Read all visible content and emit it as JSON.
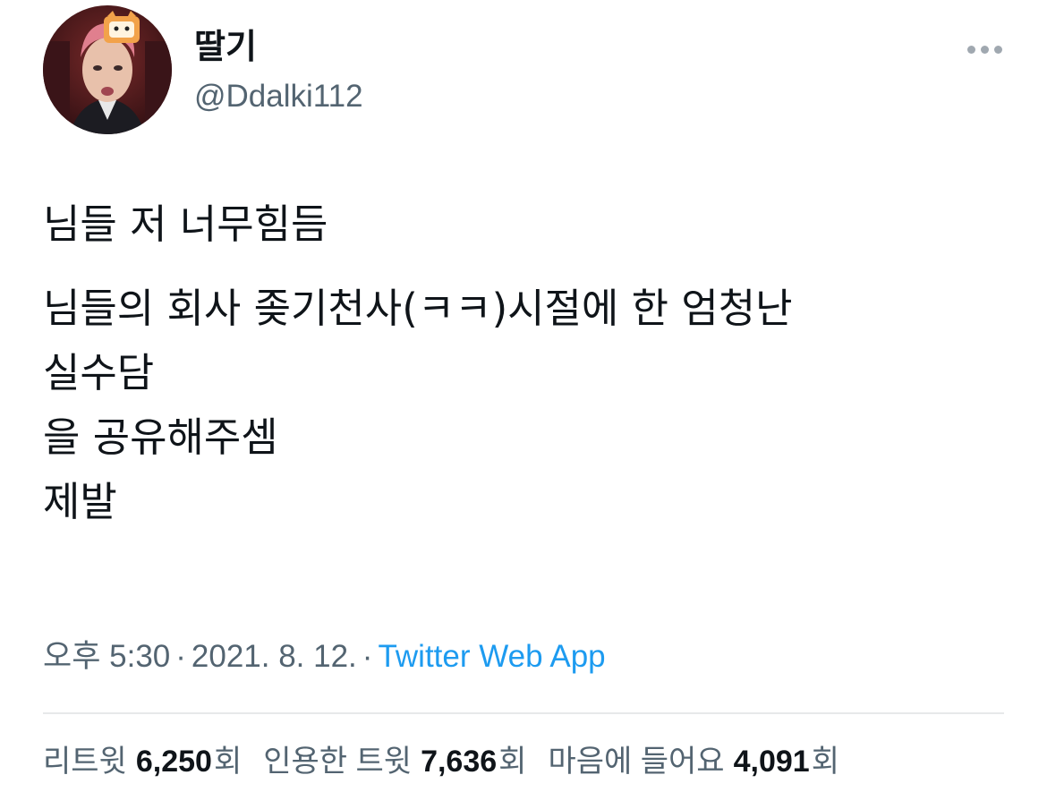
{
  "user": {
    "display_name": "딸기",
    "username": "@Ddalki112"
  },
  "tweet": {
    "line1": "님들 저 너무힘듬",
    "line2": "님들의 회사 좆기천사(ㅋㅋ)시절에 한 엄청난",
    "line3": "실수담",
    "line4": "을 공유해주셈",
    "line5": "제발"
  },
  "meta": {
    "time": "오후 5:30",
    "separator": "·",
    "date": "2021. 8. 12.",
    "source": "Twitter Web App"
  },
  "stats": {
    "retweets_label": "리트윗",
    "retweets_count": "6,250",
    "retweets_unit": "회",
    "quotes_label": "인용한 트윗",
    "quotes_count": "7,636",
    "quotes_unit": "회",
    "likes_label": "마음에 들어요",
    "likes_count": "4,091",
    "likes_unit": "회"
  },
  "icons": {
    "more": "more-horizontal-icon"
  },
  "colors": {
    "text": "#0f1419",
    "secondary": "#536471",
    "link": "#1d9bf0",
    "divider": "#e7e9ea"
  }
}
